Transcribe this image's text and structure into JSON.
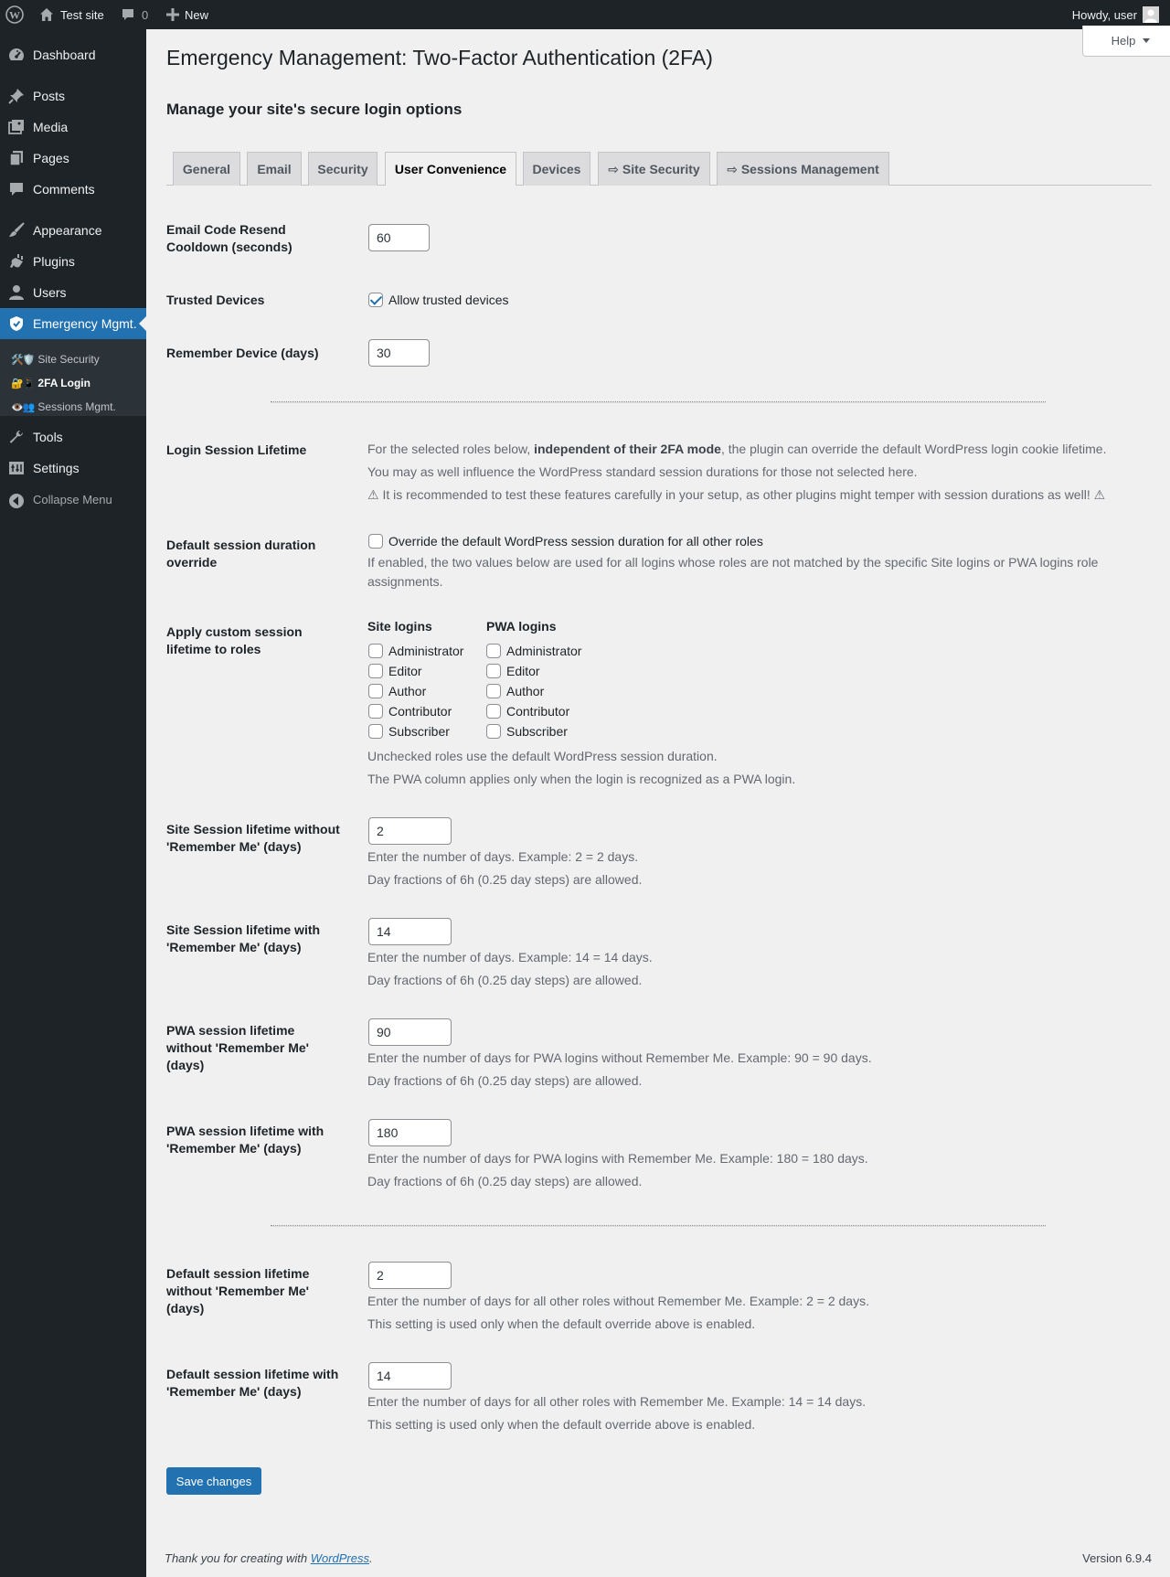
{
  "adminbar": {
    "site_name": "Test site",
    "comments_count": "0",
    "new_label": "New",
    "howdy": "Howdy, user"
  },
  "sidebar": {
    "items": [
      {
        "label": "Dashboard",
        "icon": "dashboard-icon"
      },
      {
        "label": "Posts",
        "icon": "pushpin-icon"
      },
      {
        "label": "Media",
        "icon": "media-icon"
      },
      {
        "label": "Pages",
        "icon": "pages-icon"
      },
      {
        "label": "Comments",
        "icon": "comment-icon"
      },
      {
        "label": "Appearance",
        "icon": "brush-icon"
      },
      {
        "label": "Plugins",
        "icon": "plugin-icon"
      },
      {
        "label": "Users",
        "icon": "user-icon"
      },
      {
        "label": "Emergency Mgmt.",
        "icon": "shield-icon"
      },
      {
        "label": "Tools",
        "icon": "wrench-icon"
      },
      {
        "label": "Settings",
        "icon": "settings-icon"
      }
    ],
    "submenu": [
      {
        "emoji": "🛠️🛡️",
        "label": "Site Security"
      },
      {
        "emoji": "🔐📱",
        "label": "2FA Login"
      },
      {
        "emoji": "👁️👥",
        "label": "Sessions Mgmt."
      }
    ],
    "collapse_label": "Collapse Menu"
  },
  "header": {
    "title": "Emergency Management: Two-Factor Authentication (2FA)",
    "subtitle": "Manage your site's secure login options",
    "help_label": "Help"
  },
  "tabs": [
    {
      "label": "General"
    },
    {
      "label": "Email"
    },
    {
      "label": "Security"
    },
    {
      "label": "User Convenience",
      "active": true
    },
    {
      "label": "Devices"
    },
    {
      "label": "⇨ Site Security"
    },
    {
      "label": "⇨ Sessions Management"
    }
  ],
  "form": {
    "resend_cooldown": {
      "label": "Email Code Resend Cooldown (seconds)",
      "value": "60"
    },
    "trusted_devices": {
      "label": "Trusted Devices",
      "checkbox_label": "Allow trusted devices",
      "checked": true
    },
    "remember_device": {
      "label": "Remember Device (days)",
      "value": "30"
    },
    "login_session": {
      "label": "Login Session Lifetime",
      "desc1_pre": "For the selected roles below, ",
      "desc1_bold": "independent of their 2FA mode",
      "desc1_post": ", the plugin can override the default WordPress login cookie lifetime.",
      "desc2": "You may as well influence the WordPress standard session durations for those not selected here.",
      "desc3": "⚠ It is recommended to test these features carefully in your setup, as other plugins might temper with session durations as well! ⚠"
    },
    "default_override": {
      "label": "Default session duration override",
      "checkbox_label": "Override the default WordPress session duration for all other roles",
      "checked": false,
      "desc": "If enabled, the two values below are used for all logins whose roles are not matched by the specific Site logins or PWA logins role",
      "desc2": "assignments."
    },
    "roles": {
      "label": "Apply custom session lifetime to roles",
      "site_heading": "Site logins",
      "pwa_heading": "PWA logins",
      "site_roles": [
        {
          "label": "Administrator",
          "checked": false
        },
        {
          "label": "Editor",
          "checked": false
        },
        {
          "label": "Author",
          "checked": false
        },
        {
          "label": "Contributor",
          "checked": false
        },
        {
          "label": "Subscriber",
          "checked": false
        }
      ],
      "pwa_roles": [
        {
          "label": "Administrator",
          "checked": false
        },
        {
          "label": "Editor",
          "checked": false
        },
        {
          "label": "Author",
          "checked": false
        },
        {
          "label": "Contributor",
          "checked": false
        },
        {
          "label": "Subscriber",
          "checked": false
        }
      ],
      "note1": "Unchecked roles use the default WordPress session duration.",
      "note2": "The PWA column applies only when the login is recognized as a PWA login."
    },
    "site_no_remember": {
      "label": "Site Session lifetime without 'Remember Me' (days)",
      "value": "2",
      "desc1": "Enter the number of days. Example: 2 = 2 days.",
      "desc2": "Day fractions of 6h (0.25 day steps) are allowed."
    },
    "site_remember": {
      "label": "Site Session lifetime with 'Remember Me' (days)",
      "value": "14",
      "desc1": "Enter the number of days. Example: 14 = 14 days.",
      "desc2": "Day fractions of 6h (0.25 day steps) are allowed."
    },
    "pwa_no_remember": {
      "label": "PWA session lifetime without 'Remember Me' (days)",
      "value": "90",
      "desc1": "Enter the number of days for PWA logins without Remember Me. Example: 90 = 90 days.",
      "desc2": "Day fractions of 6h (0.25 day steps) are allowed."
    },
    "pwa_remember": {
      "label": "PWA session lifetime with 'Remember Me' (days)",
      "value": "180",
      "desc1": "Enter the number of days for PWA logins with Remember Me. Example: 180 = 180 days.",
      "desc2": "Day fractions of 6h (0.25 day steps) are allowed."
    },
    "default_no_remember": {
      "label": "Default session lifetime without 'Remember Me' (days)",
      "value": "2",
      "desc1": "Enter the number of days for all other roles without Remember Me. Example: 2 = 2 days.",
      "desc2": "This setting is used only when the default override above is enabled."
    },
    "default_remember": {
      "label": "Default session lifetime with 'Remember Me' (days)",
      "value": "14",
      "desc1": "Enter the number of days for all other roles with Remember Me. Example: 14 = 14 days.",
      "desc2": "This setting is used only when the default override above is enabled."
    },
    "save_label": "Save changes"
  },
  "footer": {
    "thanks_pre": "Thank you for creating with ",
    "thanks_link": "WordPress",
    "thanks_post": ".",
    "version": "Version 6.9.4"
  },
  "colors": {
    "accent": "#2271b1",
    "sidebar_bg": "#1d2327",
    "page_bg": "#f0f0f1"
  }
}
